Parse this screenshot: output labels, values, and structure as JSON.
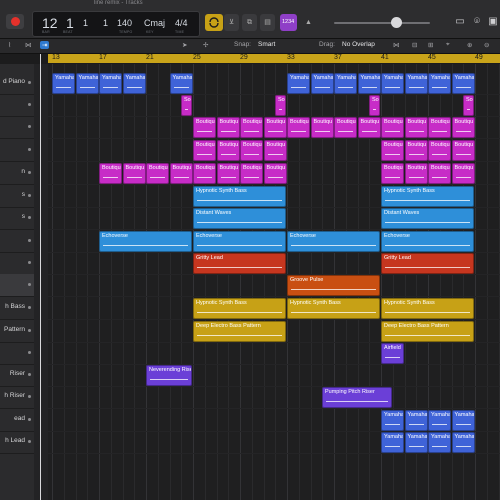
{
  "window_title": "line remix - Tracks",
  "lcd": {
    "bar": "12",
    "beat": "1",
    "div": "1",
    "tick": "1",
    "tempo": "140",
    "key": "Cmaj",
    "sig": "4/4",
    "bar_label": "BAR",
    "beat_label": "BEAT",
    "tempo_label": "TEMPO",
    "key_label": "KEY",
    "sig_label": "TIME"
  },
  "count_in_label": "1234",
  "toolbar": {
    "snap_label": "Snap:",
    "snap_value": "Smart",
    "drag_label": "Drag:",
    "drag_value": "No Overlap"
  },
  "ruler": {
    "bars": [
      "13",
      "17",
      "21",
      "25",
      "29",
      "33",
      "37",
      "41",
      "45",
      "49"
    ]
  },
  "tracks": [
    {
      "name": "d Piano"
    },
    {
      "name": ""
    },
    {
      "name": ""
    },
    {
      "name": ""
    },
    {
      "name": "n"
    },
    {
      "name": "s"
    },
    {
      "name": "s"
    },
    {
      "name": ""
    },
    {
      "name": ""
    },
    {
      "name": ""
    },
    {
      "name": "h Bass"
    },
    {
      "name": "Pattern"
    },
    {
      "name": ""
    },
    {
      "name": "Riser"
    },
    {
      "name": "h Riser"
    },
    {
      "name": "ead"
    },
    {
      "name": "h Lead"
    }
  ],
  "regions": {
    "yamaha": "Yamaha",
    "soc": "SoC",
    "boutique": "Boutiqu",
    "hypnotic": "Hypnotic Synth Bass",
    "distant": "Distant Waves",
    "echoverse": "Echoverse",
    "gritty": "Gritty Lead",
    "groove": "Groove Pulse",
    "deep": "Deep Electro Bass Pattern",
    "airfield": "Airfield",
    "neverending": "Neverending Rise",
    "pumping": "Pumping Pitch Riser"
  },
  "colors": {
    "blue": "#3f63d8",
    "magenta": "#c72cc7",
    "cyan": "#2e8fd9",
    "red": "#c6361f",
    "orange": "#c94f12",
    "yellow": "#c7a116",
    "purple": "#6b3fd7",
    "cycle": "#c9a41a"
  }
}
